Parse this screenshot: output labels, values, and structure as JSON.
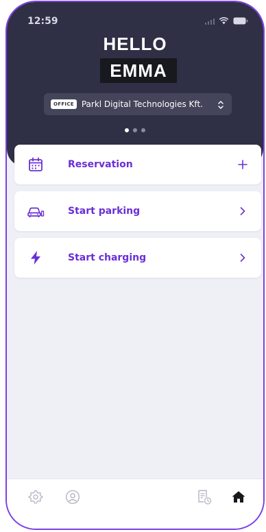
{
  "status_bar": {
    "time": "12:59"
  },
  "greeting": {
    "hello": "HELLO",
    "name": "EMMA"
  },
  "company_selector": {
    "tag": "OFFICE",
    "company": "Parkl Digital Technologies Kft."
  },
  "carousel": {
    "pages": 3,
    "active_index": 0
  },
  "actions": [
    {
      "label": "Reservation",
      "icon": "calendar-icon",
      "trailing": "plus-icon"
    },
    {
      "label": "Start parking",
      "icon": "car-icon",
      "trailing": "chevron-right-icon"
    },
    {
      "label": "Start charging",
      "icon": "lightning-icon",
      "trailing": "chevron-right-icon"
    }
  ],
  "bottom_nav": {
    "items": [
      {
        "icon": "gear-icon",
        "active": false
      },
      {
        "icon": "user-icon",
        "active": false
      },
      {
        "icon": "receipt-clock-icon",
        "active": false
      },
      {
        "icon": "home-icon",
        "active": true
      }
    ]
  },
  "colors": {
    "accent": "#6a2fd6",
    "frame": "#7b3fe4",
    "header": "#2f2f45",
    "background": "#eef0f6"
  }
}
